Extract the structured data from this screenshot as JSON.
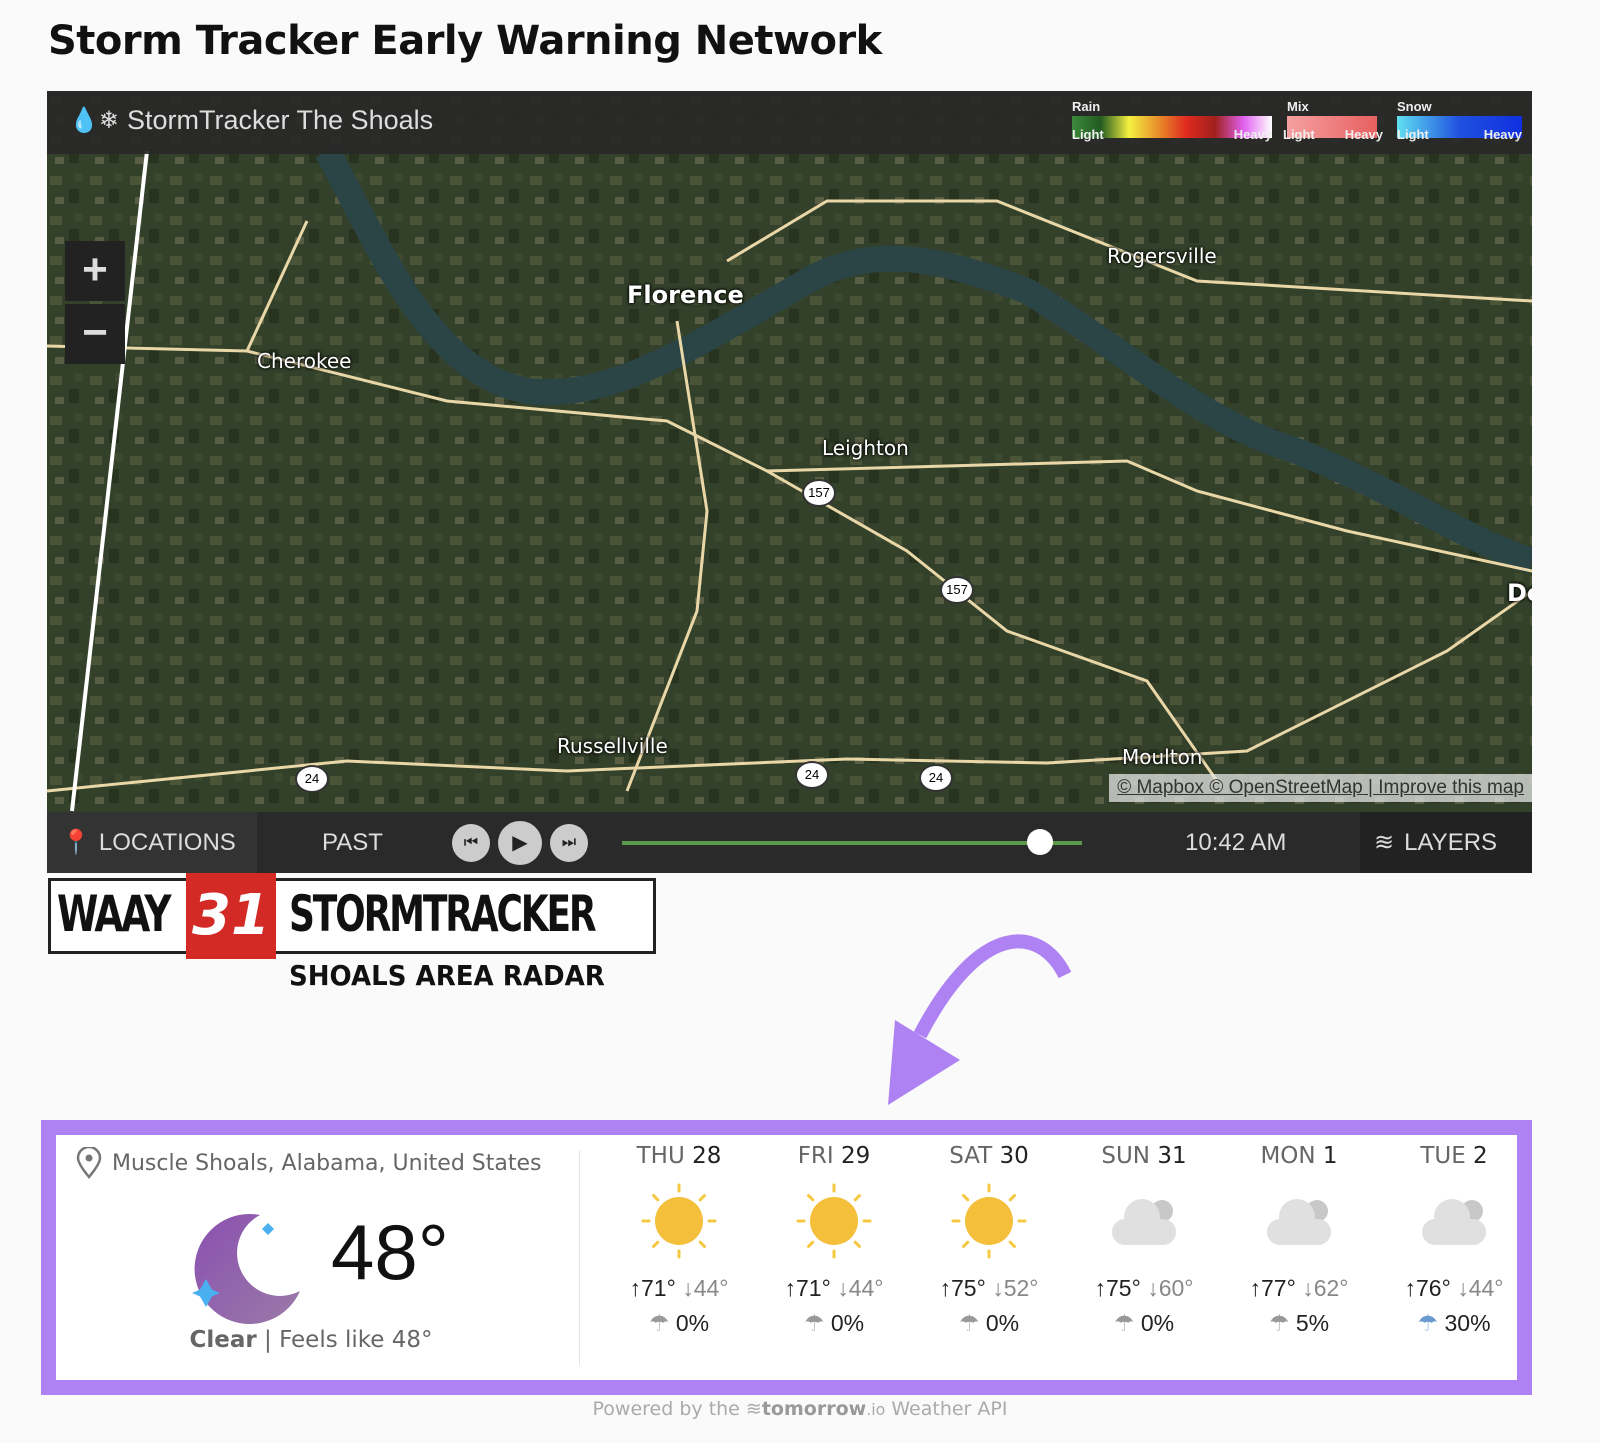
{
  "page_title": "Storm Tracker Early Warning Network",
  "radar": {
    "brand": "StormTracker The Shoals",
    "legend": [
      {
        "name": "Rain",
        "light": "Light",
        "heavy": "Heavy"
      },
      {
        "name": "Mix",
        "light": "Light",
        "heavy": "Heavy"
      },
      {
        "name": "Snow",
        "light": "Light",
        "heavy": "Heavy"
      }
    ],
    "zoom_in": "+",
    "zoom_out": "−",
    "cities": [
      "Florence",
      "Rogersville",
      "Cherokee",
      "Leighton",
      "Russellville",
      "Moulton",
      "De"
    ],
    "highways": [
      "157",
      "157",
      "24",
      "24",
      "24"
    ],
    "attribution": {
      "mapbox": "© Mapbox",
      "osm": "© OpenStreetMap",
      "improve": "Improve this map"
    },
    "controls": {
      "locations": "LOCATIONS",
      "past": "PAST",
      "time": "10:42 AM",
      "layers": "LAYERS",
      "timeline_progress": 0.88
    }
  },
  "logo": {
    "station": "WAAY",
    "channel": "31",
    "brand": "STORMTRACKER",
    "subtitle": "SHOALS AREA RADAR"
  },
  "weather": {
    "location": "Muscle Shoals, Alabama, United States",
    "temperature": "48°",
    "condition": "Clear",
    "separator": "|",
    "feels_like": "Feels like 48°",
    "icon": "moon-stars-icon",
    "forecast": [
      {
        "dow": "THU",
        "date": "28",
        "icon": "sun",
        "high": "71°",
        "low": "44°",
        "precip": "0%"
      },
      {
        "dow": "FRI",
        "date": "29",
        "icon": "sun",
        "high": "71°",
        "low": "44°",
        "precip": "0%"
      },
      {
        "dow": "SAT",
        "date": "30",
        "icon": "sun",
        "high": "75°",
        "low": "52°",
        "precip": "0%"
      },
      {
        "dow": "SUN",
        "date": "31",
        "icon": "cloud",
        "high": "75°",
        "low": "60°",
        "precip": "0%"
      },
      {
        "dow": "MON",
        "date": "1",
        "icon": "cloud",
        "high": "77°",
        "low": "62°",
        "precip": "5%"
      },
      {
        "dow": "TUE",
        "date": "2",
        "icon": "cloud",
        "high": "76°",
        "low": "44°",
        "precip": "30%"
      }
    ]
  },
  "footer": {
    "prefix": "Powered by the",
    "brand": "tomorrow",
    "brand_suffix": ".io",
    "suffix": "Weather API"
  },
  "colors": {
    "highlight": "#ae82f2",
    "arrow": "#ae82f2"
  }
}
